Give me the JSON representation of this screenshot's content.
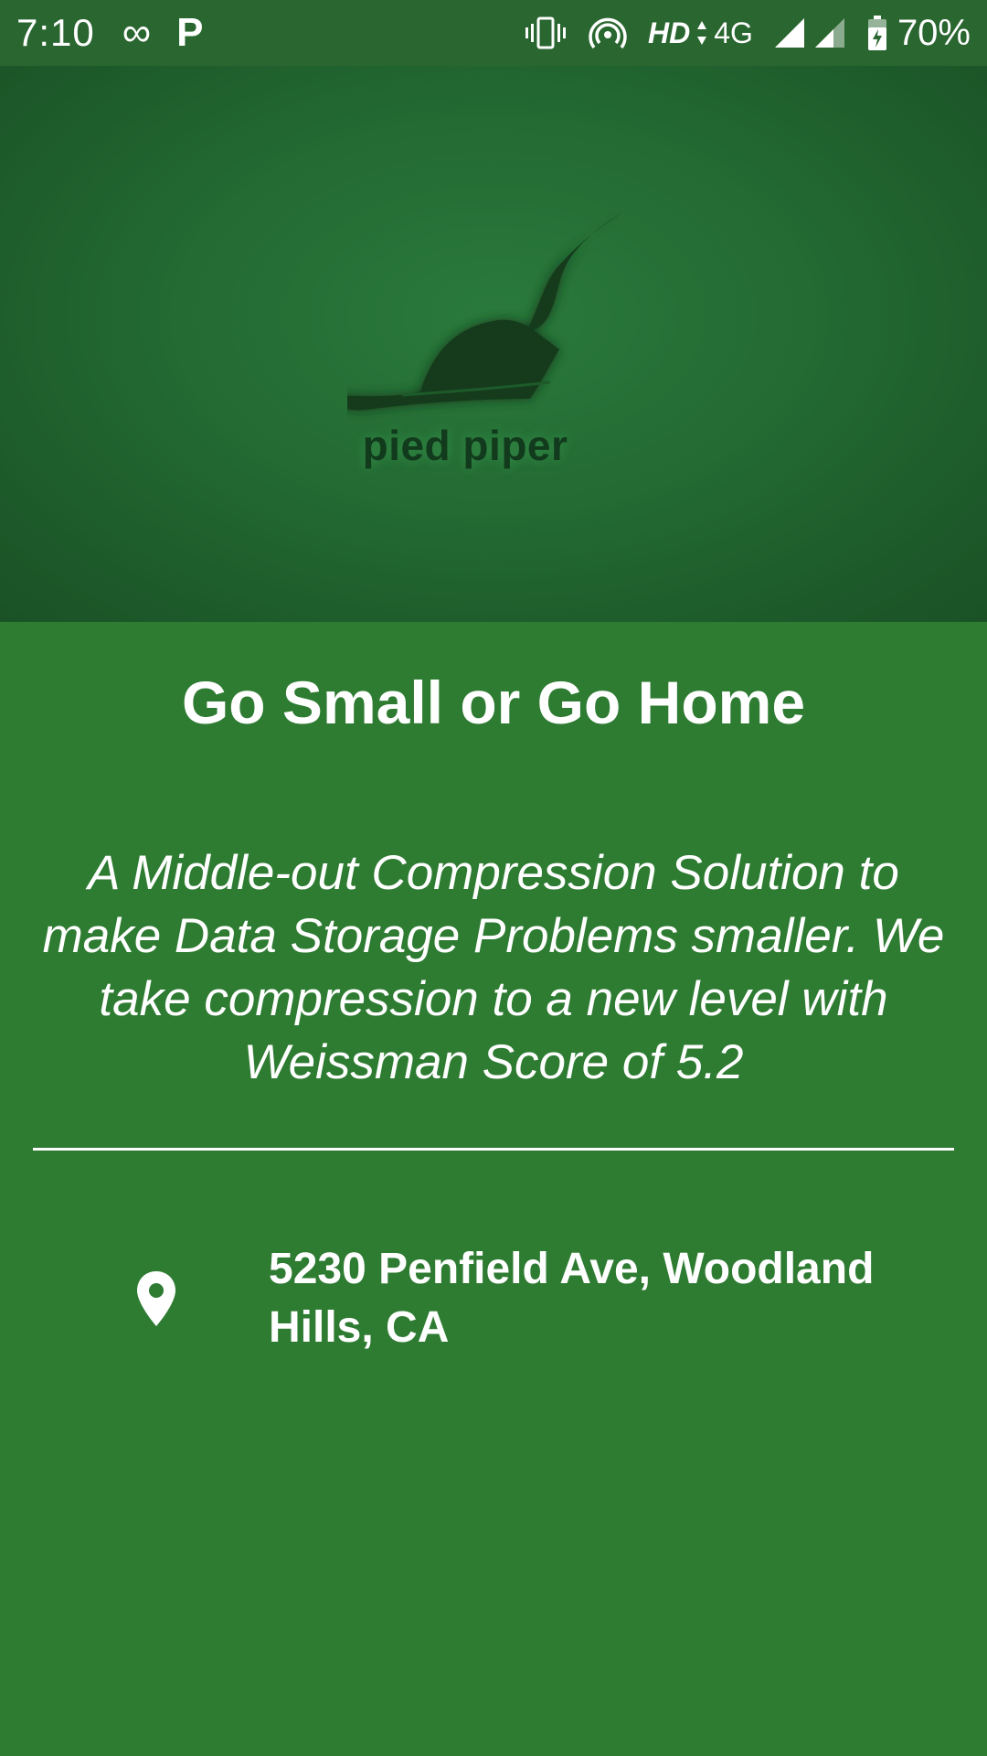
{
  "status_bar": {
    "time": "7:10",
    "infinity_glyph": "∞",
    "p_glyph": "P",
    "hd_label": "HD",
    "network_label": "4G",
    "battery_percent": "70%"
  },
  "hero": {
    "logo_text": "pied piper"
  },
  "main": {
    "headline": "Go Small or Go Home",
    "tagline": "A Middle-out Compression Solution to make Data Storage Problems smaller. We take compression to a new level with Weissman Score of 5.2",
    "address": "5230 Penfield Ave, Woodland Hills, CA"
  },
  "colors": {
    "background": "#2e7b32",
    "status_bar": "#2a6630",
    "text": "#ffffff",
    "logo_dark": "#123a1c"
  },
  "icons": [
    "vibrate-icon",
    "hotspot-icon",
    "signal-icon",
    "battery-charging-icon",
    "location-pin-icon",
    "pied-piper-logo"
  ]
}
